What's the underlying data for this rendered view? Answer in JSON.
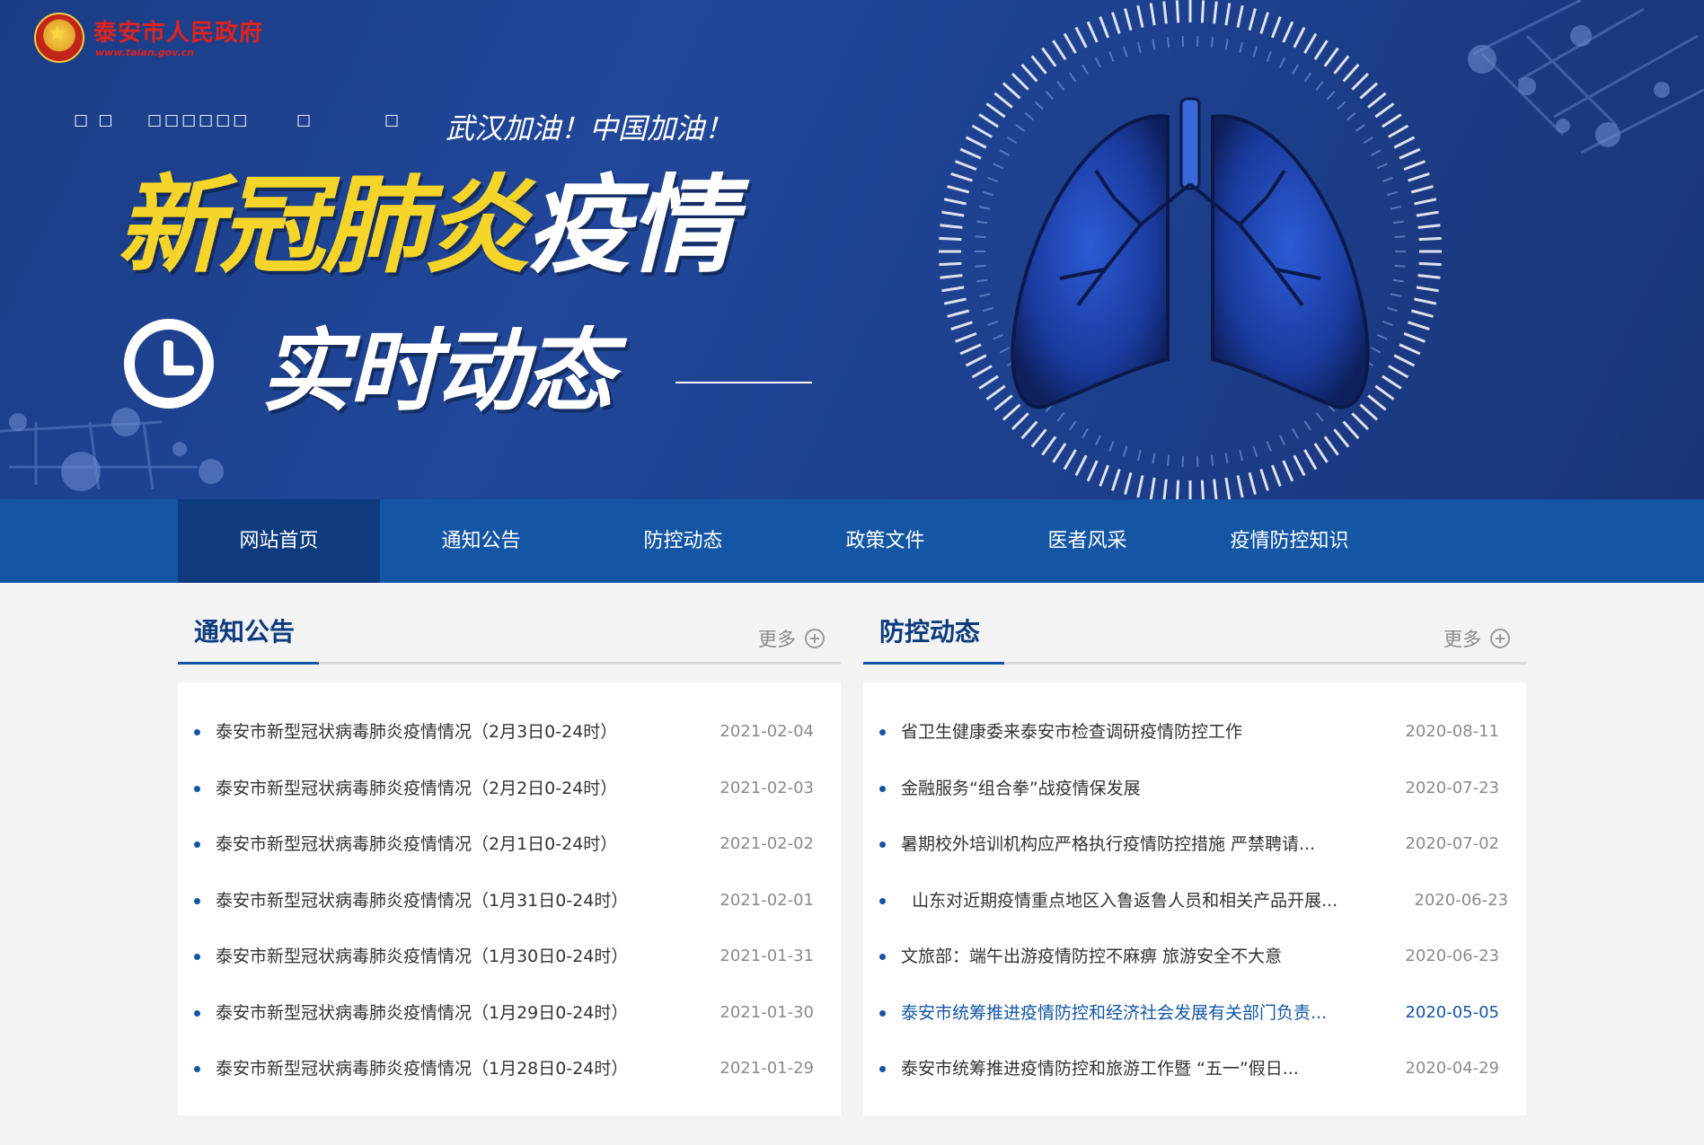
{
  "header": {
    "site_name": "泰安市人民政府",
    "site_url": "www.taian.gov.cn",
    "glyph_rows": [
      "□ □",
      "□□□□□□",
      "□",
      "□"
    ],
    "slogan": "武汉加油！中国加油！",
    "title_yellow": "新冠肺炎",
    "title_white": "疫情",
    "subtitle": "实时动态",
    "colors": {
      "banner": "#1d3f8c",
      "title_yellow": "#f6d52a"
    }
  },
  "nav": {
    "items": [
      {
        "label": "网站首页",
        "active": true
      },
      {
        "label": "通知公告",
        "active": false
      },
      {
        "label": "防控动态",
        "active": false
      },
      {
        "label": "政策文件",
        "active": false
      },
      {
        "label": "医者风采",
        "active": false
      },
      {
        "label": "疫情防控知识",
        "active": false
      }
    ],
    "colors": {
      "bar": "#1456a4",
      "active": "#0d3b7e"
    }
  },
  "notices": {
    "title": "通知公告",
    "more": "更多",
    "items": [
      {
        "title": "泰安市新型冠状病毒肺炎疫情情况（2月3日0-24时）",
        "date": "2021-02-04"
      },
      {
        "title": "泰安市新型冠状病毒肺炎疫情情况（2月2日0-24时）",
        "date": "2021-02-03"
      },
      {
        "title": "泰安市新型冠状病毒肺炎疫情情况（2月1日0-24时）",
        "date": "2021-02-02"
      },
      {
        "title": "泰安市新型冠状病毒肺炎疫情情况（1月31日0-24时）",
        "date": "2021-02-01"
      },
      {
        "title": "泰安市新型冠状病毒肺炎疫情情况（1月30日0-24时）",
        "date": "2021-01-31"
      },
      {
        "title": "泰安市新型冠状病毒肺炎疫情情况（1月29日0-24时）",
        "date": "2021-01-30"
      },
      {
        "title": "泰安市新型冠状病毒肺炎疫情情况（1月28日0-24时）",
        "date": "2021-01-29"
      }
    ]
  },
  "dynamics": {
    "title": "防控动态",
    "more": "更多",
    "items": [
      {
        "title": "省卫生健康委来泰安市检查调研疫情防控工作",
        "date": "2020-08-11"
      },
      {
        "title": "金融服务“组合拳”战疫情保发展",
        "date": "2020-07-23"
      },
      {
        "title": "暑期校外培训机构应严格执行疫情防控措施 严禁聘请...",
        "date": "2020-07-02"
      },
      {
        "title": "  山东对近期疫情重点地区入鲁返鲁人员和相关产品开展...",
        "date": "2020-06-23"
      },
      {
        "title": "文旅部：端午出游疫情防控不麻痹 旅游安全不大意",
        "date": "2020-06-23"
      },
      {
        "title": "泰安市统筹推进疫情防控和经济社会发展有关部门负责...",
        "date": "2020-05-05"
      },
      {
        "title": "泰安市统筹推进疫情防控和旅游工作暨 “五一”假日...",
        "date": "2020-04-29"
      }
    ]
  }
}
